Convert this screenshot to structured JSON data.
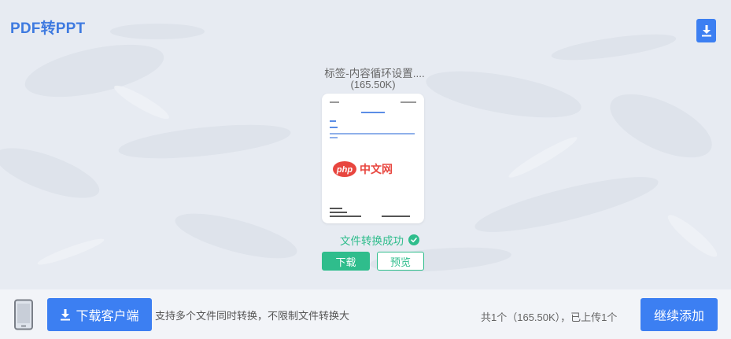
{
  "header": {
    "app_title": "PDF转PPT",
    "download_icon": "download-icon"
  },
  "file": {
    "name": "标签-内容循环设置....",
    "size": "(165.50K)",
    "thumbnail_watermark": "php中文网",
    "status_text": "文件转换成功",
    "status_icon": "check-circle-icon",
    "download_label": "下载",
    "preview_label": "预览"
  },
  "footer": {
    "device_icon": "phone-icon",
    "client_button_label": "下载客户端",
    "promo_text": "支持多个文件同时转换，不限制文件转换大",
    "summary_text": "共1个（165.50K），已上传1个",
    "add_button_label": "继续添加"
  },
  "colors": {
    "primary_blue": "#3c7ff2",
    "success_green": "#2fbd8c",
    "workspace_bg": "#e7ebf2",
    "watermark_red": "#e8463f"
  }
}
